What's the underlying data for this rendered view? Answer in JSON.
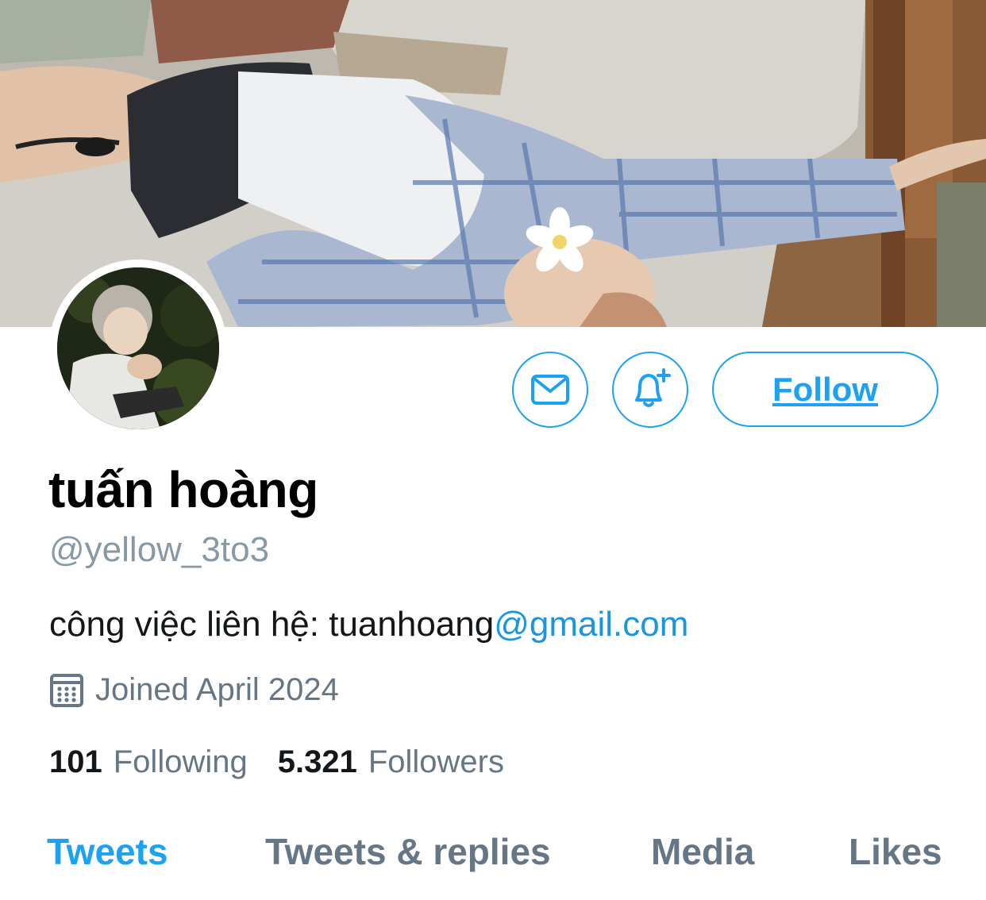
{
  "profile": {
    "name": "tuấn hoàng",
    "handle": "@yellow_3to3",
    "bio_text": "công việc liên hệ: tuanhoang",
    "bio_link": "@gmail.com",
    "joined": "Joined April 2024",
    "following_count": "101",
    "following_label": "Following",
    "followers_count": "5.321",
    "followers_label": "Followers"
  },
  "actions": {
    "message_icon": "mail-icon",
    "notify_icon": "bell-plus-icon",
    "follow_label": "Follow"
  },
  "tabs": [
    {
      "label": "Tweets",
      "active": true
    },
    {
      "label": "Tweets & replies",
      "active": false
    },
    {
      "label": "Media",
      "active": false
    },
    {
      "label": "Likes",
      "active": false
    }
  ],
  "colors": {
    "accent": "#1da1f2",
    "link": "#1b95e0",
    "muted": "#657786",
    "text": "#14171a"
  }
}
